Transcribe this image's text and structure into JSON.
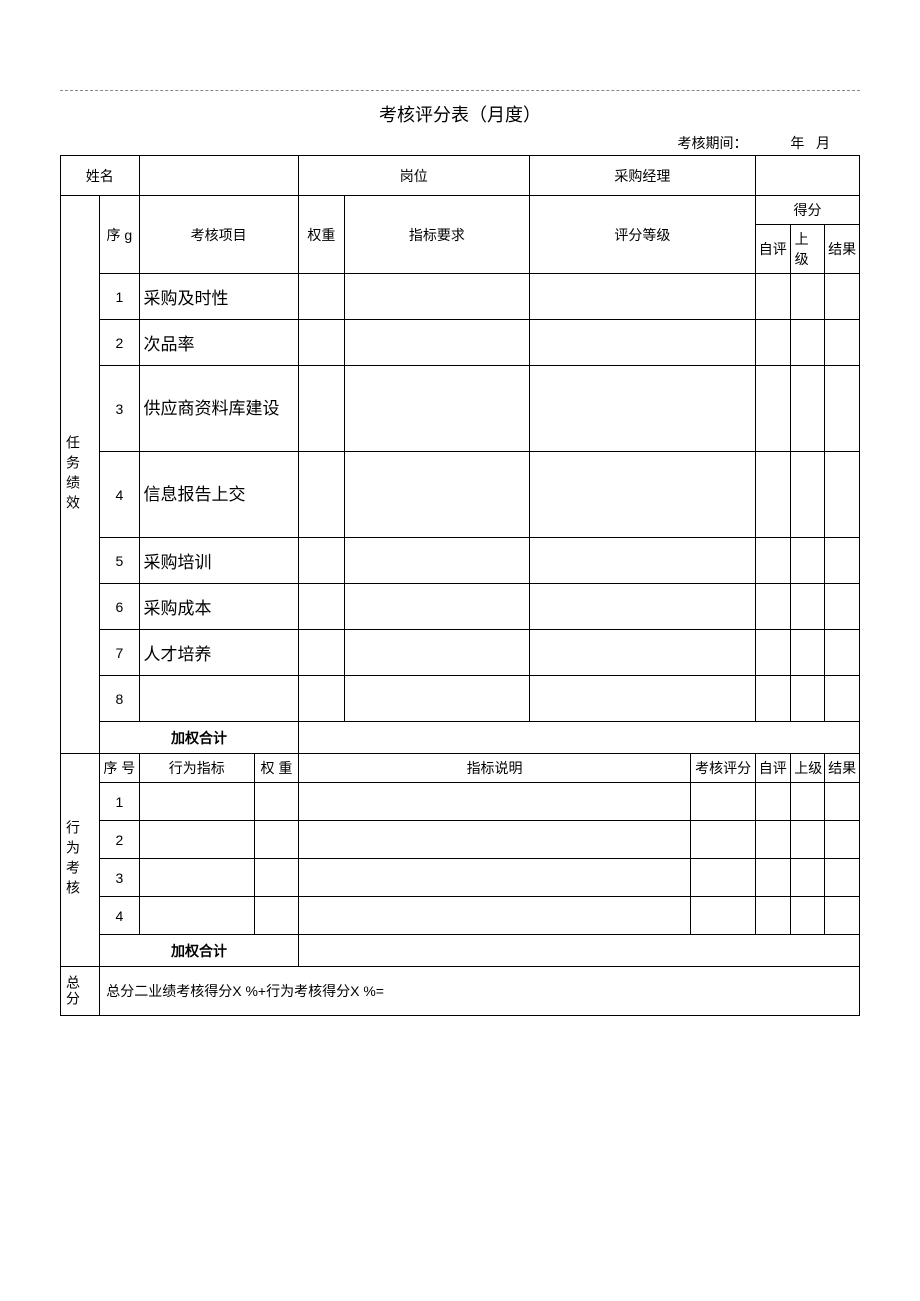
{
  "doc": {
    "title": "考核评分表（月度）",
    "period_label": "考核期间：",
    "period_year_unit": "年",
    "period_month_unit": "月"
  },
  "info_row": {
    "name_label": "姓名",
    "position_label": "岗位",
    "position_value": "采购经理"
  },
  "task_section": {
    "group_label": "任务绩效",
    "headers": {
      "seq": "序",
      "seq_sub": "g",
      "item": "考核项目",
      "weight": "权重",
      "requirement": "指标要求",
      "grade": "评分等级",
      "score": "得分",
      "self": "自评",
      "superior": "上级",
      "result": "结果"
    },
    "rows": [
      {
        "no": "1",
        "item": "采购及时性"
      },
      {
        "no": "2",
        "item": "次品率"
      },
      {
        "no": "3",
        "item": "供应商资料库建设"
      },
      {
        "no": "4",
        "item": "信息报告上交"
      },
      {
        "no": "5",
        "item": "采购培训"
      },
      {
        "no": "6",
        "item": "采购成本"
      },
      {
        "no": "7",
        "item": "人才培养"
      },
      {
        "no": "8",
        "item": ""
      }
    ],
    "subtotal_label": "加权合计"
  },
  "behavior_section": {
    "group_label": "行为考核",
    "headers": {
      "seq": "序 号",
      "indicator": "行为指标",
      "weight": "权 重",
      "description": "指标说明",
      "score": "考核评分",
      "self": "自评",
      "superior": "上级",
      "result": "结果"
    },
    "rows": [
      {
        "no": "1"
      },
      {
        "no": "2"
      },
      {
        "no": "3"
      },
      {
        "no": "4"
      }
    ],
    "subtotal_label": "加权合计"
  },
  "total_section": {
    "label": "总分",
    "formula": "总分二业绩考核得分X %+行为考核得分X %="
  }
}
